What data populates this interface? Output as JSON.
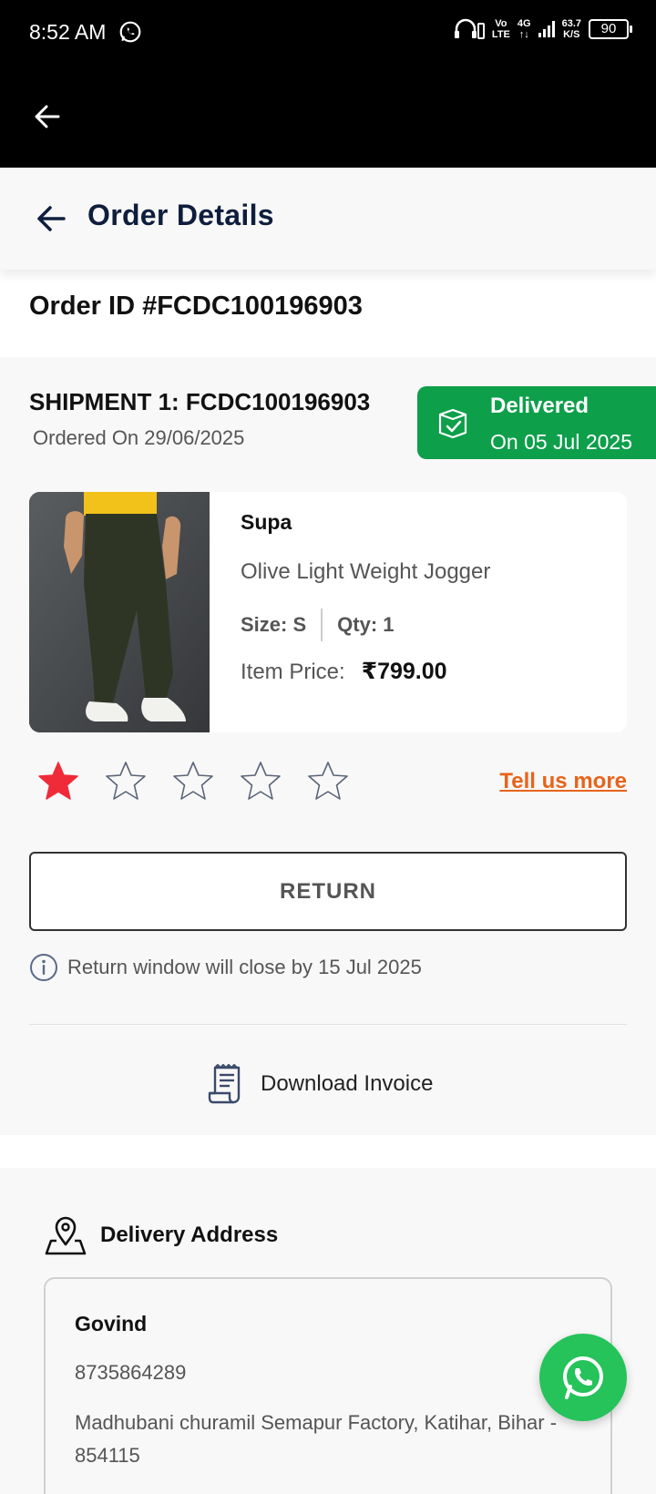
{
  "status_bar": {
    "time": "8:52 AM",
    "network_top": "Vo",
    "network_bottom": "LTE",
    "net_gen_top": "4G",
    "net_gen_bottom": "↑↓",
    "speed_top": "63.7",
    "speed_bottom": "K/S",
    "battery": "90"
  },
  "header": {
    "title": "Order Details"
  },
  "order": {
    "id_label": "Order ID #FCDC100196903"
  },
  "shipment": {
    "title": "SHIPMENT 1: FCDC100196903",
    "ordered_on": "Ordered On 29/06/2025",
    "status": "Delivered",
    "status_date": "On 05 Jul 2025",
    "status_color": "#0e9f4b"
  },
  "product": {
    "brand": "Supa",
    "name": "Olive Light Weight Jogger",
    "size": "Size: S",
    "qty": "Qty: 1",
    "price_label": "Item Price:",
    "price": "₹799.00"
  },
  "rating": {
    "stars_total": 5,
    "stars_filled": 1,
    "filled_color": "#ef2b3a",
    "tell_more": "Tell us more",
    "tell_more_color": "#e8631a"
  },
  "actions": {
    "return_label": "RETURN",
    "return_note": "Return window will close by 15 Jul 2025",
    "invoice_label": "Download Invoice"
  },
  "address": {
    "title": "Delivery Address",
    "name": "Govind",
    "phone": "8735864289",
    "line": "Madhubani churamil Semapur Factory, Katihar, Bihar - 854115"
  },
  "icons": {
    "fab": "whatsapp-icon",
    "invoice": "receipt-icon",
    "address": "map-pin-icon",
    "info": "info-icon",
    "delivered": "box-check-icon"
  }
}
